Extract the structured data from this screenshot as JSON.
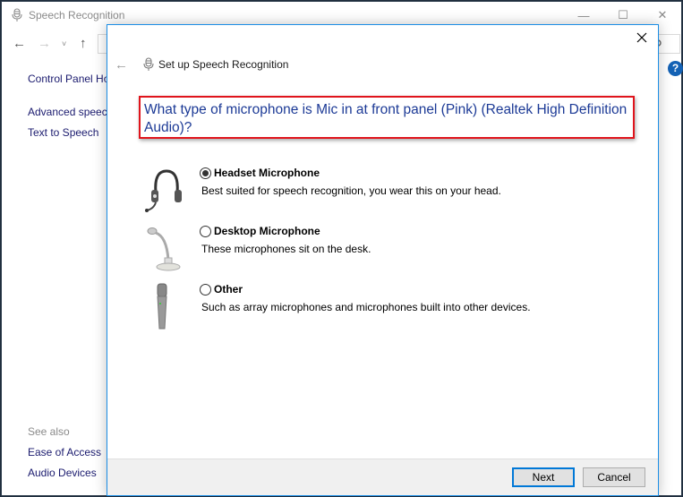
{
  "background_window": {
    "title": "Speech Recognition",
    "title_icon": "microphone-icon",
    "window_controls": {
      "minimize": "—",
      "maximize": "☐",
      "close": "✕"
    },
    "nav": {
      "back": "←",
      "forward": "→",
      "recent": "˅",
      "up": "↑"
    },
    "search_icon": "search-icon",
    "help_label": "?",
    "sidebar": {
      "links": [
        "Control Panel Home",
        "Advanced speech options",
        "Text to Speech"
      ],
      "see_also_label": "See also",
      "see_also_links": [
        "Ease of Access",
        "Audio Devices"
      ]
    }
  },
  "dialog": {
    "close_label": "✕",
    "back_label": "←",
    "title": "Set up Speech Recognition",
    "question": "What type of microphone is Mic in at front panel (Pink) (Realtek High Definition Audio)?",
    "options": [
      {
        "label": "Headset Microphone",
        "description": "Best suited for speech recognition, you wear this on your head.",
        "selected": true,
        "icon": "headset-icon"
      },
      {
        "label": "Desktop Microphone",
        "description": "These microphones sit on the desk.",
        "selected": false,
        "icon": "desktop-microphone-icon"
      },
      {
        "label": "Other",
        "description": "Such as array microphones and microphones built into other devices.",
        "selected": false,
        "icon": "handheld-microphone-icon"
      }
    ],
    "buttons": {
      "next": "Next",
      "cancel": "Cancel"
    },
    "colors": {
      "question_text": "#1c3a96",
      "highlight_border": "#e0141c",
      "accent": "#0078d7"
    }
  }
}
